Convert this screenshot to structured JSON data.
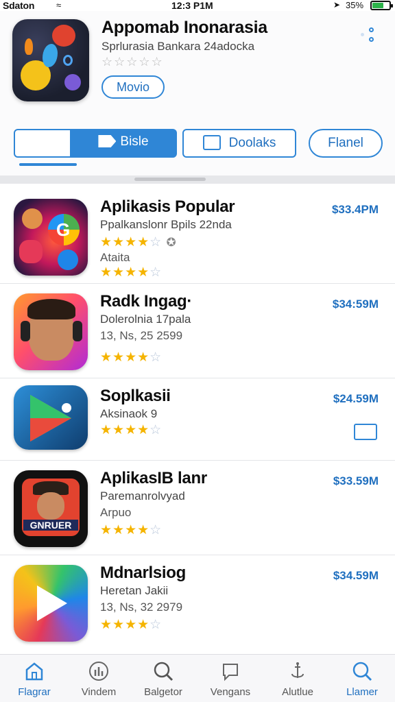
{
  "status_bar": {
    "carrier": "Sdaton",
    "time": "12:3 P1M",
    "battery_pct": "35%"
  },
  "hero": {
    "title": "Appomab Inonarasia",
    "subtitle": "Sprlurasia Bankara 24adocka",
    "stars": "☆☆☆☆☆",
    "button_label": "Movio"
  },
  "segments": {
    "first_label": "Bisle",
    "mid_label": "Doolaks",
    "last_label": "Flanel"
  },
  "apps": [
    {
      "title": "Aplikasis Popular",
      "subtitle": "Ppalkanslonr Bpils 22nda",
      "extra": "Ataita",
      "stars_top": "★★★★",
      "stars_top_empty": "☆",
      "stars_bottom": "★★★★",
      "stars_bottom_empty": "☆",
      "price": "$33.4PM"
    },
    {
      "title": "Radk Ingag·",
      "subtitle": "Dolerolnia 17pala",
      "extra": "13, Ns, 25 2599",
      "stars_bottom": "★★★★",
      "stars_bottom_empty": "☆",
      "price": "$34:59M"
    },
    {
      "title": "Soplkasii",
      "subtitle": "Aksinaok 9",
      "stars_bottom": "★★★★",
      "stars_bottom_empty": "☆",
      "price": "$24.59M"
    },
    {
      "title": "AplikasIB lanr",
      "subtitle": "Paremanrolvyad",
      "extra": "Arpuo",
      "stars_bottom": "★★★★",
      "stars_bottom_empty": "☆",
      "price": "$33.59M",
      "icon_text": "GNRUER"
    },
    {
      "title": "Mdnarlsiog",
      "subtitle": "Heretan Jakii",
      "extra": "13, Ns, 32 2979",
      "stars_bottom": "★★★★",
      "stars_bottom_empty": "☆",
      "price": "$34.59M"
    }
  ],
  "tabs": [
    {
      "label": "Flagrar",
      "icon": "home-icon"
    },
    {
      "label": "Vindem",
      "icon": "charts-icon"
    },
    {
      "label": "Balgetor",
      "icon": "search-icon"
    },
    {
      "label": "Vengans",
      "icon": "chat-icon"
    },
    {
      "label": "Alutlue",
      "icon": "anchor-icon"
    },
    {
      "label": "Llamer",
      "icon": "search-icon"
    }
  ],
  "colors": {
    "accent": "#2f86d6",
    "star": "#f5b400",
    "price": "#1f6fbf"
  }
}
